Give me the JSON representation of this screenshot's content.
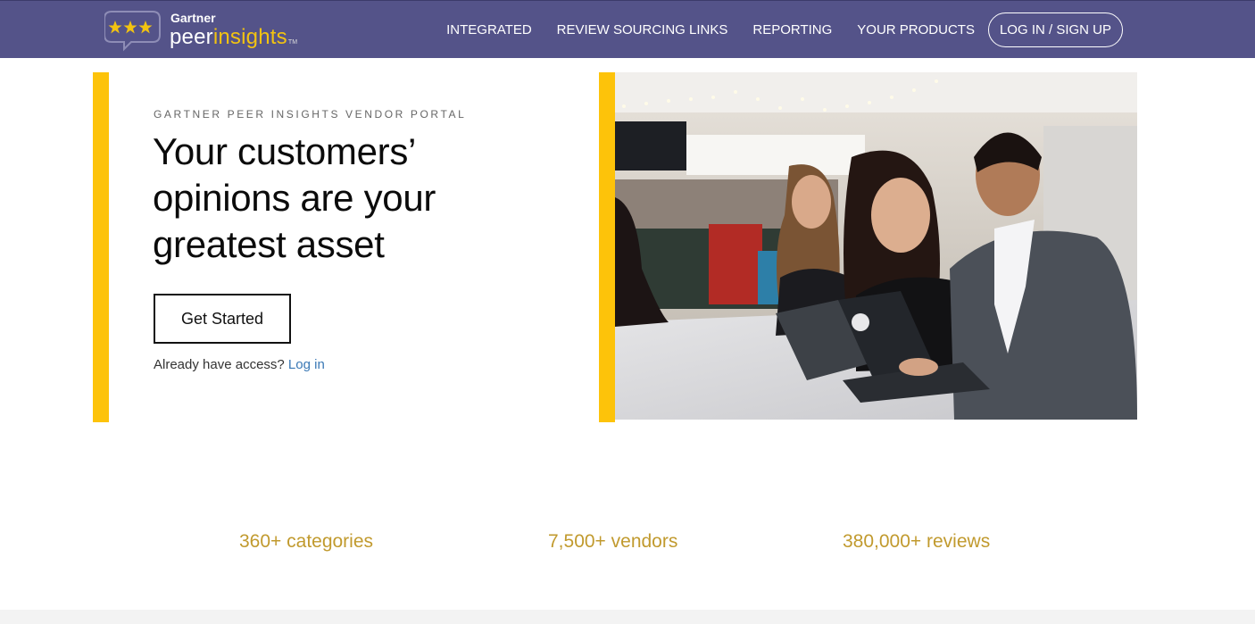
{
  "brand": {
    "gartner": "Gartner",
    "peer": "peer",
    "insights": "insights",
    "tm": "TM"
  },
  "nav": {
    "items": [
      {
        "label": "INTEGRATED"
      },
      {
        "label": "REVIEW SOURCING LINKS"
      },
      {
        "label": "REPORTING"
      },
      {
        "label": "YOUR PRODUCTS"
      }
    ],
    "login_label": "LOG IN / SIGN UP"
  },
  "hero": {
    "eyebrow": "GARTNER PEER INSIGHTS VENDOR PORTAL",
    "headline": "Your customers’ opinions are your greatest asset",
    "cta_label": "Get Started",
    "access_text": "Already have access?",
    "login_link": "Log in"
  },
  "stats": [
    {
      "label": "360+ categories"
    },
    {
      "label": "7,500+ vendors"
    },
    {
      "label": "380,000+ reviews"
    }
  ],
  "colors": {
    "nav_bg": "#545389",
    "accent_yellow": "#fdc30a",
    "stat_gold": "#c19a2e",
    "link_blue": "#3a78b5"
  }
}
